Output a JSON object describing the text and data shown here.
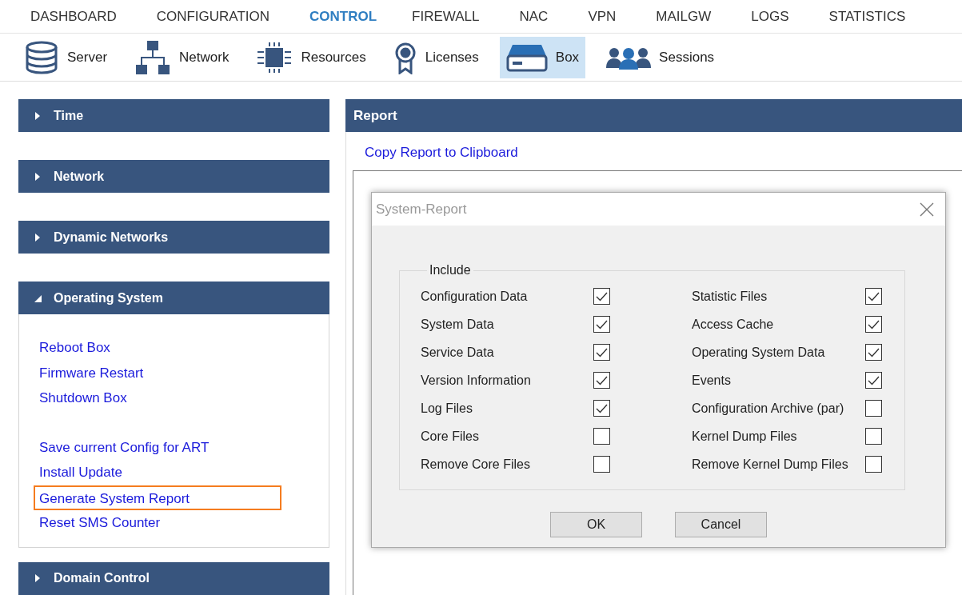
{
  "nav_tabs": [
    {
      "label": "DASHBOARD",
      "selected": false
    },
    {
      "label": "CONFIGURATION",
      "selected": false
    },
    {
      "label": "CONTROL",
      "selected": true
    },
    {
      "label": "FIREWALL",
      "selected": false
    },
    {
      "label": "NAC",
      "selected": false
    },
    {
      "label": "VPN",
      "selected": false
    },
    {
      "label": "MAILGW",
      "selected": false
    },
    {
      "label": "LOGS",
      "selected": false
    },
    {
      "label": "STATISTICS",
      "selected": false
    }
  ],
  "toolbar": [
    {
      "label": "Server",
      "selected": false
    },
    {
      "label": "Network",
      "selected": false
    },
    {
      "label": "Resources",
      "selected": false
    },
    {
      "label": "Licenses",
      "selected": false
    },
    {
      "label": "Box",
      "selected": true
    },
    {
      "label": "Sessions",
      "selected": false
    }
  ],
  "sidebar": [
    {
      "title": "Time",
      "expanded": false
    },
    {
      "title": "Network",
      "expanded": false
    },
    {
      "title": "Dynamic Networks",
      "expanded": false
    },
    {
      "title": "Operating System",
      "expanded": true,
      "groups": [
        [
          {
            "label": "Reboot Box",
            "highlighted": false
          },
          {
            "label": "Firmware Restart",
            "highlighted": false
          },
          {
            "label": "Shutdown Box",
            "highlighted": false
          }
        ],
        [
          {
            "label": "Save current Config for ART",
            "highlighted": false
          },
          {
            "label": "Install Update",
            "highlighted": false
          },
          {
            "label": "Generate System Report",
            "highlighted": true
          },
          {
            "label": "Reset SMS Counter",
            "highlighted": false
          }
        ]
      ]
    },
    {
      "title": "Domain Control",
      "expanded": false
    }
  ],
  "report": {
    "title": "Report",
    "link": "Copy Report to Clipboard",
    "dialog": {
      "title": "System-Report",
      "group_label": "Include",
      "columns": [
        [
          {
            "label": "Configuration Data",
            "checked": true
          },
          {
            "label": "System Data",
            "checked": true
          },
          {
            "label": "Service Data",
            "checked": true
          },
          {
            "label": "Version Information",
            "checked": true
          },
          {
            "label": "Log Files",
            "checked": true
          },
          {
            "label": "Core Files",
            "checked": false
          },
          {
            "label": "Remove Core Files",
            "checked": false
          }
        ],
        [
          {
            "label": "Statistic Files",
            "checked": true
          },
          {
            "label": "Access Cache",
            "checked": true
          },
          {
            "label": "Operating System Data",
            "checked": true
          },
          {
            "label": "Events",
            "checked": true
          },
          {
            "label": "Configuration Archive (par)",
            "checked": false
          },
          {
            "label": "Kernel Dump Files",
            "checked": false
          },
          {
            "label": "Remove Kernel Dump Files",
            "checked": false
          }
        ]
      ],
      "buttons": [
        "OK",
        "Cancel"
      ]
    }
  }
}
